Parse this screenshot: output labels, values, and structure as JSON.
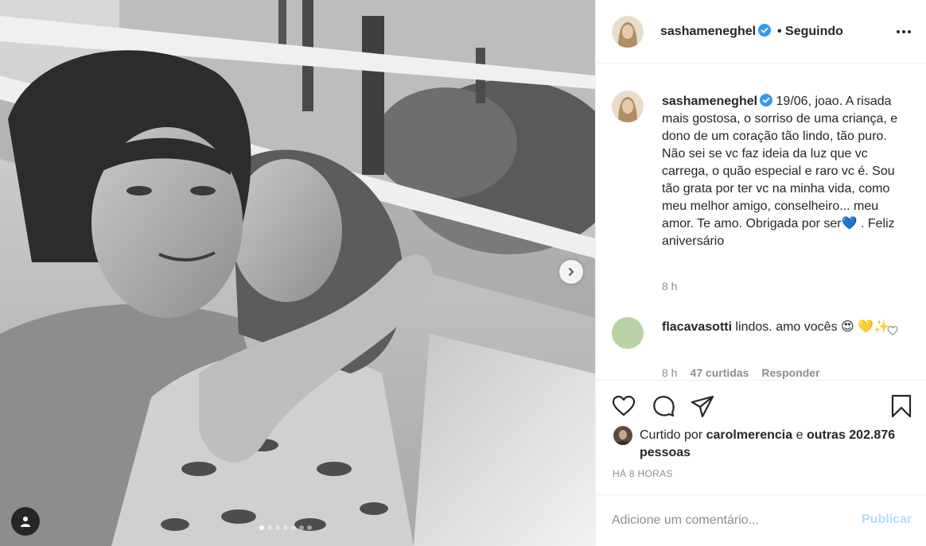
{
  "post": {
    "username": "sashameneghel",
    "follow_status": "Seguindo",
    "caption_date": "19/06, joao.",
    "caption_text": "A risada mais gostosa, o sorriso de uma criança, e dono de um coração tão lindo, tão puro. Não sei se vc faz ideia da luz que vc carrega, o quão especial e raro vc é. Sou tão grata por ter vc na minha vida, como meu melhor amigo, conselheiro... meu amor. Te amo. Obrigada por ser",
    "caption_emoji": "💙",
    "caption_end": " . Feliz aniversário",
    "caption_time": "8 h",
    "carousel": {
      "count": 7,
      "active_index": 0
    }
  },
  "comment": {
    "username": "flacavasotti",
    "text": "lindos. amo vocês",
    "emojis": "😍 💛✨",
    "time": "8 h",
    "likes": "47 curtidas",
    "reply_label": "Responder"
  },
  "likes": {
    "prefix": "Curtido por",
    "liker": "carolmerencia",
    "connector": "e",
    "others": "outras 202.876 pessoas"
  },
  "timestamp": "HÁ 8 HORAS",
  "add_comment": {
    "placeholder": "Adicione um comentário...",
    "publish_label": "Publicar"
  },
  "icons": {
    "like": "heart-icon",
    "comment": "comment-icon",
    "share": "share-icon",
    "save": "bookmark-icon",
    "verified": "verified-badge-icon",
    "more": "more-options-icon",
    "next": "chevron-right-icon",
    "tagged": "user-tag-icon"
  },
  "colors": {
    "verified_blue": "#3897f0",
    "muted_text": "#8e8e8e",
    "publish_disabled": "#b2dffc"
  }
}
